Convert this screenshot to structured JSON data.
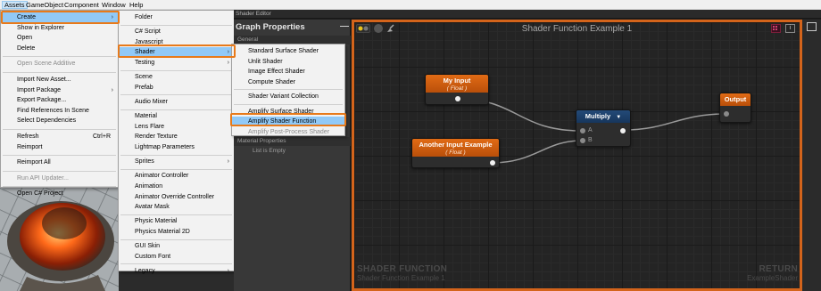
{
  "menubar": [
    "Assets",
    "GameObject",
    "Component",
    "Window",
    "Help"
  ],
  "assets_menu": [
    {
      "label": "Create",
      "arrow": true,
      "highlight": true
    },
    {
      "label": "Show in Explorer"
    },
    {
      "label": "Open"
    },
    {
      "label": "Delete"
    },
    {
      "sep": true
    },
    {
      "label": "Open Scene Additive",
      "disabled": true
    },
    {
      "sep": true
    },
    {
      "label": "Import New Asset..."
    },
    {
      "label": "Import Package",
      "arrow": true
    },
    {
      "label": "Export Package..."
    },
    {
      "label": "Find References In Scene"
    },
    {
      "label": "Select Dependencies"
    },
    {
      "sep": true
    },
    {
      "label": "Refresh",
      "shortcut": "Ctrl+R"
    },
    {
      "label": "Reimport"
    },
    {
      "sep": true
    },
    {
      "label": "Reimport All"
    },
    {
      "sep": true
    },
    {
      "label": "Run API Updater...",
      "disabled": true
    },
    {
      "sep": true
    },
    {
      "label": "Open C# Project"
    }
  ],
  "create_menu": [
    {
      "label": "Folder"
    },
    {
      "sep": true
    },
    {
      "label": "C# Script"
    },
    {
      "label": "Javascript"
    },
    {
      "label": "Shader",
      "arrow": true,
      "highlight": true
    },
    {
      "label": "Testing",
      "arrow": true
    },
    {
      "sep": true
    },
    {
      "label": "Scene"
    },
    {
      "label": "Prefab"
    },
    {
      "sep": true
    },
    {
      "label": "Audio Mixer"
    },
    {
      "sep": true
    },
    {
      "label": "Material"
    },
    {
      "label": "Lens Flare"
    },
    {
      "label": "Render Texture"
    },
    {
      "label": "Lightmap Parameters"
    },
    {
      "sep": true
    },
    {
      "label": "Sprites",
      "arrow": true
    },
    {
      "sep": true
    },
    {
      "label": "Animator Controller"
    },
    {
      "label": "Animation"
    },
    {
      "label": "Animator Override Controller"
    },
    {
      "label": "Avatar Mask"
    },
    {
      "sep": true
    },
    {
      "label": "Physic Material"
    },
    {
      "label": "Physics Material 2D"
    },
    {
      "sep": true
    },
    {
      "label": "GUI Skin"
    },
    {
      "label": "Custom Font"
    },
    {
      "sep": true
    },
    {
      "label": "Legacy",
      "arrow": true
    }
  ],
  "shader_menu": [
    {
      "label": "Standard Surface Shader"
    },
    {
      "label": "Unlit Shader"
    },
    {
      "label": "Image Effect Shader"
    },
    {
      "label": "Compute Shader"
    },
    {
      "sep": true
    },
    {
      "label": "Shader Variant Collection"
    },
    {
      "sep": true
    },
    {
      "label": "Amplify Surface Shader"
    },
    {
      "label": "Amplify Shader Function",
      "highlight": true
    },
    {
      "label": "Amplify Post-Process Shader",
      "disabled": true
    }
  ],
  "shader_editor": {
    "tab": "Shader Editor",
    "properties_title": "Graph Properties",
    "collapse": "—",
    "section_general": "General",
    "section_material": "Material Properties",
    "list_empty": "List is Empty",
    "canvas_title": "Shader Function Example 1",
    "watermark_left_big": "SHADER FUNCTION",
    "watermark_left_small": "Shader Function Example 1",
    "watermark_right_big": "RETURN",
    "watermark_right_small": "ExampleShader"
  },
  "nodes": {
    "my_input": {
      "title": "My Input",
      "type": "( Float )"
    },
    "another_input": {
      "title": "Another Input Example",
      "type": "( Float )"
    },
    "multiply": {
      "title": "Multiply",
      "port_a": "A",
      "port_b": "B"
    },
    "output": {
      "title": "Output"
    }
  },
  "colors": {
    "accent_orange": "#e87a1a",
    "menu_highlight": "#91c9f7",
    "node_orange": "#d35e10",
    "node_blue": "#1e426c"
  }
}
